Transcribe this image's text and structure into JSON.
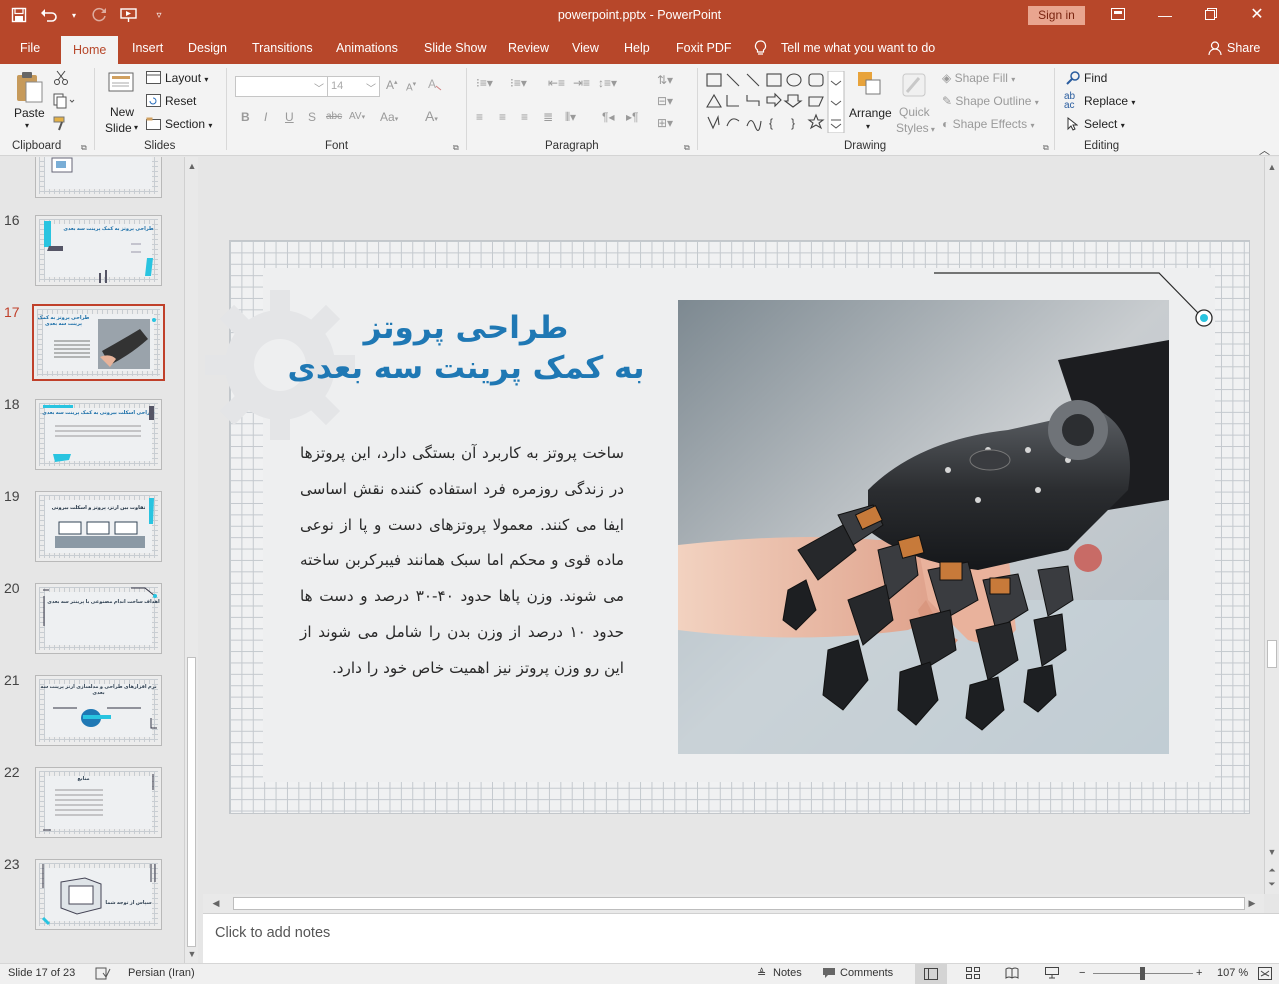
{
  "window": {
    "title": "powerpoint.pptx  -  PowerPoint",
    "signin": "Sign in",
    "qat_icons": [
      "save-icon",
      "undo-icon",
      "redo-icon",
      "start-from-beginning-icon",
      "customize-qat-icon"
    ]
  },
  "tabs": {
    "file": "File",
    "home": "Home",
    "insert": "Insert",
    "design": "Design",
    "transitions": "Transitions",
    "animations": "Animations",
    "slideshow": "Slide Show",
    "review": "Review",
    "view": "View",
    "help": "Help",
    "foxit": "Foxit PDF",
    "tell": "Tell me what you want to do",
    "share": "Share"
  },
  "ribbon": {
    "clipboard": {
      "paste": "Paste",
      "label": "Clipboard"
    },
    "slides": {
      "new_slide_1": "New",
      "new_slide_2": "Slide",
      "layout": "Layout",
      "reset": "Reset",
      "section": "Section",
      "label": "Slides"
    },
    "font": {
      "size": "14",
      "label": "Font",
      "bold": "B",
      "italic": "I",
      "underline": "U",
      "shadow": "S",
      "strike": "abc",
      "spacing": "AV",
      "case": "Aa",
      "color": "A"
    },
    "paragraph": {
      "label": "Paragraph"
    },
    "drawing": {
      "arrange": "Arrange",
      "quick_styles_1": "Quick",
      "quick_styles_2": "Styles",
      "shape_fill": "Shape Fill",
      "shape_outline": "Shape Outline",
      "shape_effects": "Shape Effects",
      "label": "Drawing"
    },
    "editing": {
      "find": "Find",
      "replace": "Replace",
      "select": "Select",
      "label": "Editing"
    }
  },
  "thumbnails": [
    {
      "num": "16",
      "title": "طراحی پروتز به کمک پرینت سه بعدی"
    },
    {
      "num": "17",
      "title": "طراحی پروتز به کمک پرینت سه بعدی",
      "selected": true
    },
    {
      "num": "18",
      "title": "طراحی اسکلت بیرونی به کمک پرینت سه بعدی"
    },
    {
      "num": "19",
      "title": "تفاوت بین ارتز، پروتز و اسکلت بیرونی"
    },
    {
      "num": "20",
      "title": "اهداف ساخت اندام مصنوعی با پرینتر سه بعدی"
    },
    {
      "num": "21",
      "title": "نرم افزارهای طراحی و مدلسازی ارتز پرینت سه بعدی"
    },
    {
      "num": "22",
      "title": "منابع"
    },
    {
      "num": "23",
      "title": "سپاس از توجه شما"
    }
  ],
  "slide": {
    "title_line1": "طراحی پروتز",
    "title_line2": "به کمک پرینت سه بعدی",
    "body": "ساخت پروتز به کاربرد آن بستگی دارد، این پروتزها در زندگی روزمره فرد استفاده کننده نقش اساسی ایفا می کنند. معمولا پروتزهای دست و پا از نوعی ماده قوی و محکم اما سبک همانند فیبرکربن ساخته می شوند. وزن پاها حدود ۴۰-۳۰ درصد و دست ها حدود ۱۰ درصد از وزن بدن را شامل می شوند از این رو وزن پروتز نیز اهمیت خاص خود را دارد.",
    "accent_color": "#1f78b4",
    "cyan_color": "#29c4e0"
  },
  "notes": {
    "placeholder": "Click to add notes"
  },
  "status": {
    "slide_counter": "Slide 17 of 23",
    "language": "Persian (Iran)",
    "notes": "Notes",
    "comments": "Comments",
    "zoom": "107 %"
  }
}
